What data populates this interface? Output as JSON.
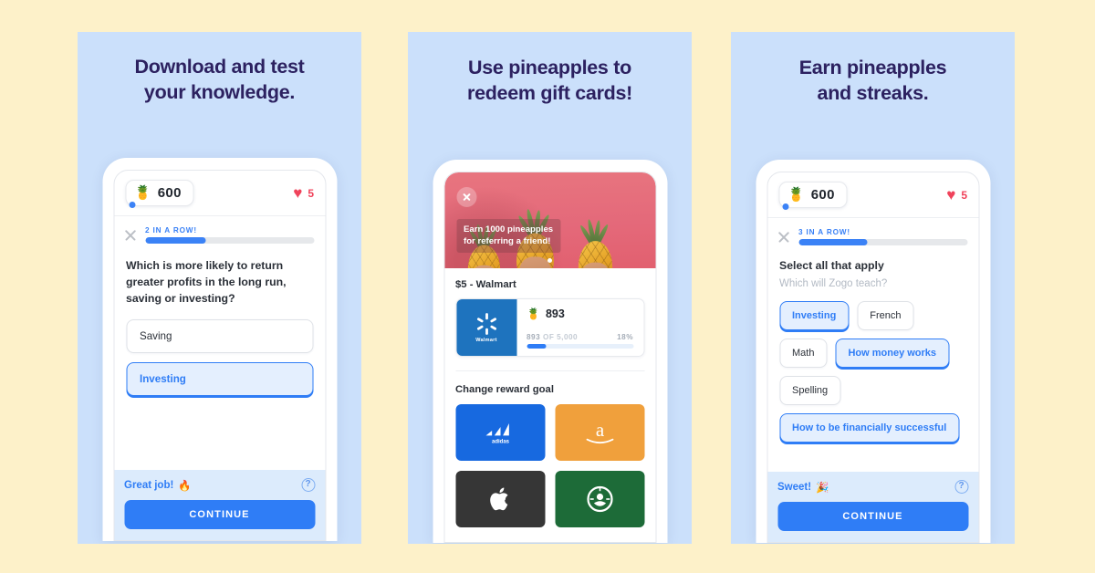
{
  "theme": {
    "page_background": "#FDF1C9",
    "panel_background": "#CBE0FB",
    "title_color": "#2C2160",
    "accent_blue": "#2F7DF6",
    "heart_red": "#F0435B"
  },
  "panels": [
    {
      "title": "Download and test\nyour knowledge.",
      "header": {
        "pineapple_emoji": "🍍",
        "pineapple_count": "600",
        "heart_icon": "♥",
        "lives_count": "5"
      },
      "streak": {
        "close_label": "×",
        "label": "2 IN A ROW!",
        "progress_percent": 36
      },
      "question": "Which is more likely to return greater profits in the long run, saving or investing?",
      "answers": [
        {
          "label": "Saving",
          "selected": false
        },
        {
          "label": "Investing",
          "selected": true
        }
      ],
      "footer": {
        "message": "Great job!",
        "message_emoji": "🔥",
        "help_icon": "?",
        "continue_label": "CONTINUE"
      }
    },
    {
      "title": "Use pineapples to\nredeem gift cards!",
      "banner": {
        "close_icon": "×",
        "caption": "Earn 1000 pineapples\nfor referring a friend!"
      },
      "reward": {
        "title": "$5 - Walmart",
        "logo_brand": "Walmart",
        "pineapple_emoji": "🍍",
        "amount": "893",
        "progress_current": "893",
        "progress_of": "OF",
        "progress_total": "5,000",
        "progress_percent_label": "18%",
        "progress_percent": 18
      },
      "section_label": "Change reward goal",
      "brands": [
        {
          "name": "adidas",
          "glyph": "adidas",
          "color": "#1769E0"
        },
        {
          "name": "amazon",
          "glyph": "a",
          "color": "#F0A03C"
        },
        {
          "name": "apple",
          "glyph": "",
          "color": "#363636"
        },
        {
          "name": "starbucks",
          "glyph": "✹",
          "color": "#1D6B38"
        }
      ]
    },
    {
      "title": "Earn pineapples\nand streaks.",
      "header": {
        "pineapple_emoji": "🍍",
        "pineapple_count": "600",
        "heart_icon": "♥",
        "lives_count": "5"
      },
      "streak": {
        "close_label": "×",
        "label": "3 IN A ROW!",
        "progress_percent": 41
      },
      "prompt_title": "Select all that apply",
      "prompt_subtitle": "Which will Zogo teach?",
      "chips": [
        {
          "label": "Investing",
          "selected": true
        },
        {
          "label": "French",
          "selected": false
        },
        {
          "label": "Math",
          "selected": false
        },
        {
          "label": "How money works",
          "selected": true
        },
        {
          "label": "Spelling",
          "selected": false
        },
        {
          "label": "How to be financially successful",
          "selected": true
        }
      ],
      "footer": {
        "message": "Sweet!",
        "message_emoji": "🎉",
        "help_icon": "?",
        "continue_label": "CONTINUE"
      }
    }
  ]
}
